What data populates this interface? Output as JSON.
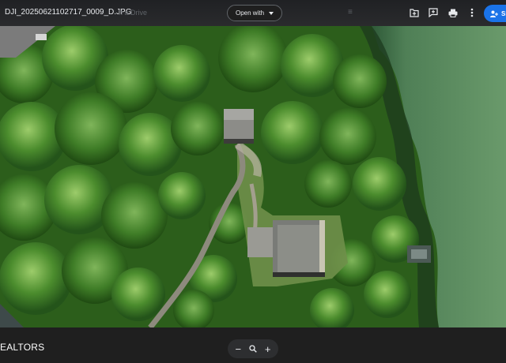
{
  "header": {
    "file_name": "DJI_20250621102717_0009_D.JPG",
    "ghost_text": "h a Drive",
    "open_with_label": "Open with",
    "share_label": "Sh",
    "icons": [
      "add-to-drive-icon",
      "comment-icon",
      "print-icon",
      "more-vert-icon",
      "share-icon"
    ]
  },
  "bottom": {
    "realtors_text": "EALTORS",
    "zoom_out_label": "−",
    "zoom_in_label": "+",
    "zoom_icon": "magnify-icon"
  },
  "colors": {
    "forest": "#2f6a1c",
    "lake": "#5a8a5f",
    "share_blue": "#1a73e8",
    "bar_dark": "#202124"
  }
}
